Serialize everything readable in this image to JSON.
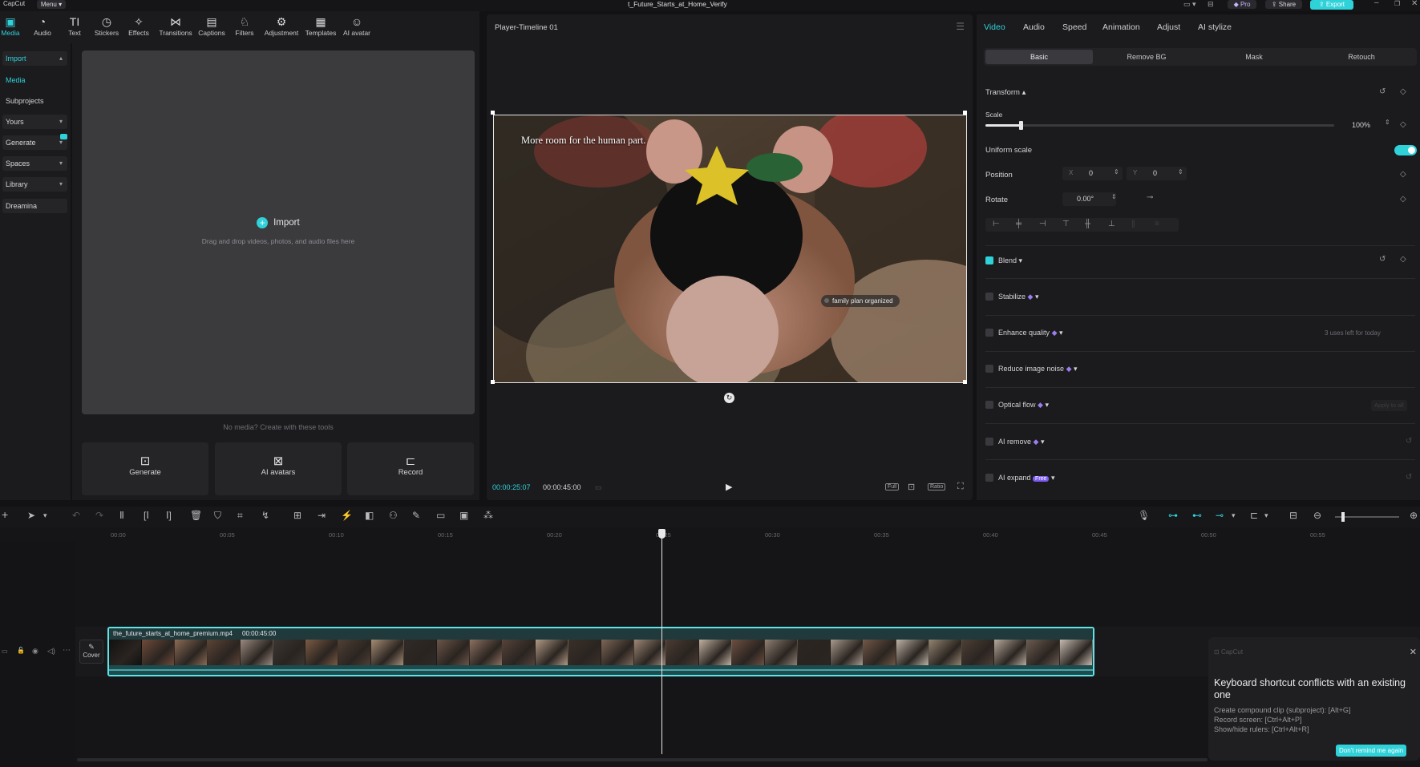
{
  "titlebar": {
    "app_name": "CapCut",
    "menu_label": "Menu",
    "project_title": "t_Future_Starts_at_Home_Verify",
    "pro_label": "Pro",
    "share_label": "Share",
    "export_label": "Export"
  },
  "toolbar": [
    {
      "label": "Media",
      "icon": "media-icon"
    },
    {
      "label": "Audio",
      "icon": "audio-icon"
    },
    {
      "label": "Text",
      "icon": "text-icon"
    },
    {
      "label": "Stickers",
      "icon": "stickers-icon"
    },
    {
      "label": "Effects",
      "icon": "effects-icon"
    },
    {
      "label": "Transitions",
      "icon": "transitions-icon"
    },
    {
      "label": "Captions",
      "icon": "captions-icon"
    },
    {
      "label": "Filters",
      "icon": "filters-icon"
    },
    {
      "label": "Adjustment",
      "icon": "adjustment-icon"
    },
    {
      "label": "Templates",
      "icon": "templates-icon"
    },
    {
      "label": "AI avatar",
      "icon": "ai-avatar-icon"
    }
  ],
  "sidebar": {
    "items": [
      {
        "label": "Import"
      },
      {
        "label": "Media"
      },
      {
        "label": "Subprojects"
      },
      {
        "label": "Yours"
      },
      {
        "label": "Generate"
      },
      {
        "label": "Spaces"
      },
      {
        "label": "Library"
      },
      {
        "label": "Dreamina"
      }
    ]
  },
  "media": {
    "import_label": "Import",
    "import_hint": "Drag and drop videos, photos, and audio files here",
    "no_media_text": "No media? Create with these tools",
    "tools": [
      {
        "label": "Generate",
        "icon": "generate-icon"
      },
      {
        "label": "AI avatars",
        "icon": "ai-avatars-icon"
      },
      {
        "label": "Record",
        "icon": "record-icon"
      }
    ]
  },
  "player": {
    "title": "Player-Timeline 01",
    "overlay_text": "More room for the human part.",
    "label_tag": "family plan organized",
    "current_time": "00:00:25:07",
    "total_time": "00:00:45:00",
    "full_label": "Full",
    "ratio_label": "Ratio"
  },
  "properties": {
    "tabs": [
      "Video",
      "Audio",
      "Speed",
      "Animation",
      "Adjust",
      "AI stylize"
    ],
    "subtabs": [
      "Basic",
      "Remove BG",
      "Mask",
      "Retouch"
    ],
    "transform_label": "Transform",
    "scale_label": "Scale",
    "scale_value": "100%",
    "scale_fraction": 0.1,
    "uniform_scale_label": "Uniform scale",
    "position_label": "Position",
    "pos_x_label": "X",
    "pos_x": "0",
    "pos_y_label": "Y",
    "pos_y": "0",
    "rotate_label": "Rotate",
    "rotate_value": "0.00°",
    "blend_label": "Blend",
    "stabilize_label": "Stabilize",
    "enhance_label": "Enhance quality",
    "enhance_note": "3 uses left for today",
    "noise_label": "Reduce image noise",
    "optical_label": "Optical flow",
    "apply_all_label": "Apply to all",
    "remove_label": "AI remove",
    "expand_label": "AI expand",
    "free_badge": "Free"
  },
  "timeline": {
    "ticks": [
      "00:00",
      "00:05",
      "00:10",
      "00:15",
      "00:20",
      "00:25",
      "00:30",
      "00:35",
      "00:40",
      "00:45",
      "00:50",
      "00:55"
    ],
    "cover_label": "Cover",
    "clip_name": "the_future_starts_at_home_premium.mp4",
    "clip_duration": "00:00:45:00"
  },
  "toast": {
    "app_label": "CapCut",
    "title": "Keyboard shortcut conflicts with an existing one",
    "lines": [
      "Create compound clip (subproject): [Alt+G]",
      "Record screen: [Ctrl+Alt+P]",
      "Show/hide rulers: [Ctrl+Alt+R]"
    ],
    "button_label": "Don't remind me again"
  },
  "colors": {
    "accent": "#2fd2d9",
    "panel": "#1b1b1e",
    "background": "#121214",
    "premium": "#9c7df0"
  }
}
